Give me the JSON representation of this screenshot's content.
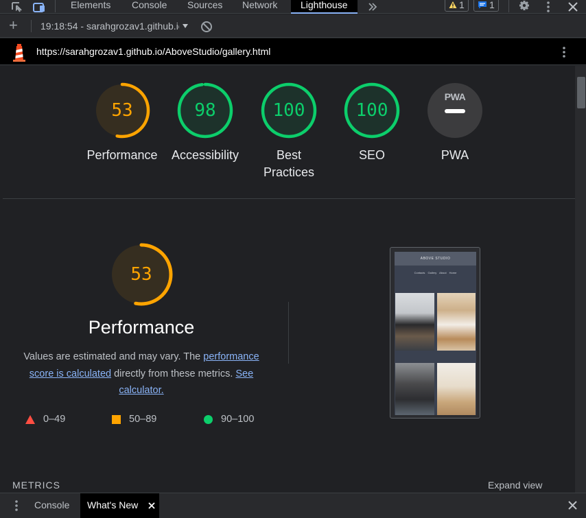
{
  "devtools": {
    "tabs": [
      {
        "label": "Elements"
      },
      {
        "label": "Console"
      },
      {
        "label": "Sources"
      },
      {
        "label": "Network"
      },
      {
        "label": "Lighthouse"
      }
    ],
    "more_tabs_icon": "double-chevron-right-icon",
    "warnings_count": "1",
    "messages_count": "1",
    "warning_color": "#fdd663",
    "message_color": "#1a73e8"
  },
  "toolbar": {
    "session_label": "19:18:54 - sarahgrozav1.github.io"
  },
  "urlbar": {
    "url": "https://sarahgrozav1.github.io/AboveStudio/gallery.html"
  },
  "scores": [
    {
      "label": "Performance",
      "value": "53",
      "color": "#ffa400",
      "fraction": 0.53
    },
    {
      "label": "Accessibility",
      "value": "98",
      "color": "#0cce6b",
      "fraction": 0.98
    },
    {
      "label": "Best Practices",
      "value": "100",
      "color": "#0cce6b",
      "fraction": 1.0
    },
    {
      "label": "SEO",
      "value": "100",
      "color": "#0cce6b",
      "fraction": 1.0
    },
    {
      "label": "PWA",
      "value": "PWA",
      "color": "#9aa0a6"
    }
  ],
  "performance": {
    "score": "53",
    "fraction": 0.53,
    "title": "Performance",
    "desc_1": "Values are estimated and may vary. The ",
    "link_1": "performance score is calculated",
    "desc_2": " directly from these metrics. ",
    "link_2": "See calculator."
  },
  "legend": [
    {
      "range": "0–49",
      "shape": "triangle",
      "color": "#ff4e42"
    },
    {
      "range": "50–89",
      "shape": "square",
      "color": "#ffa400"
    },
    {
      "range": "90–100",
      "shape": "circle",
      "color": "#0cce6b"
    }
  ],
  "screenshot": {
    "site_title": "ABOVE STUDIO",
    "nav": "Contacts Gallery About Home"
  },
  "metrics_label": "METRICS",
  "expand_view": "Expand view",
  "drawer": {
    "tabs": [
      {
        "label": "Console"
      },
      {
        "label": "What's New"
      }
    ]
  }
}
